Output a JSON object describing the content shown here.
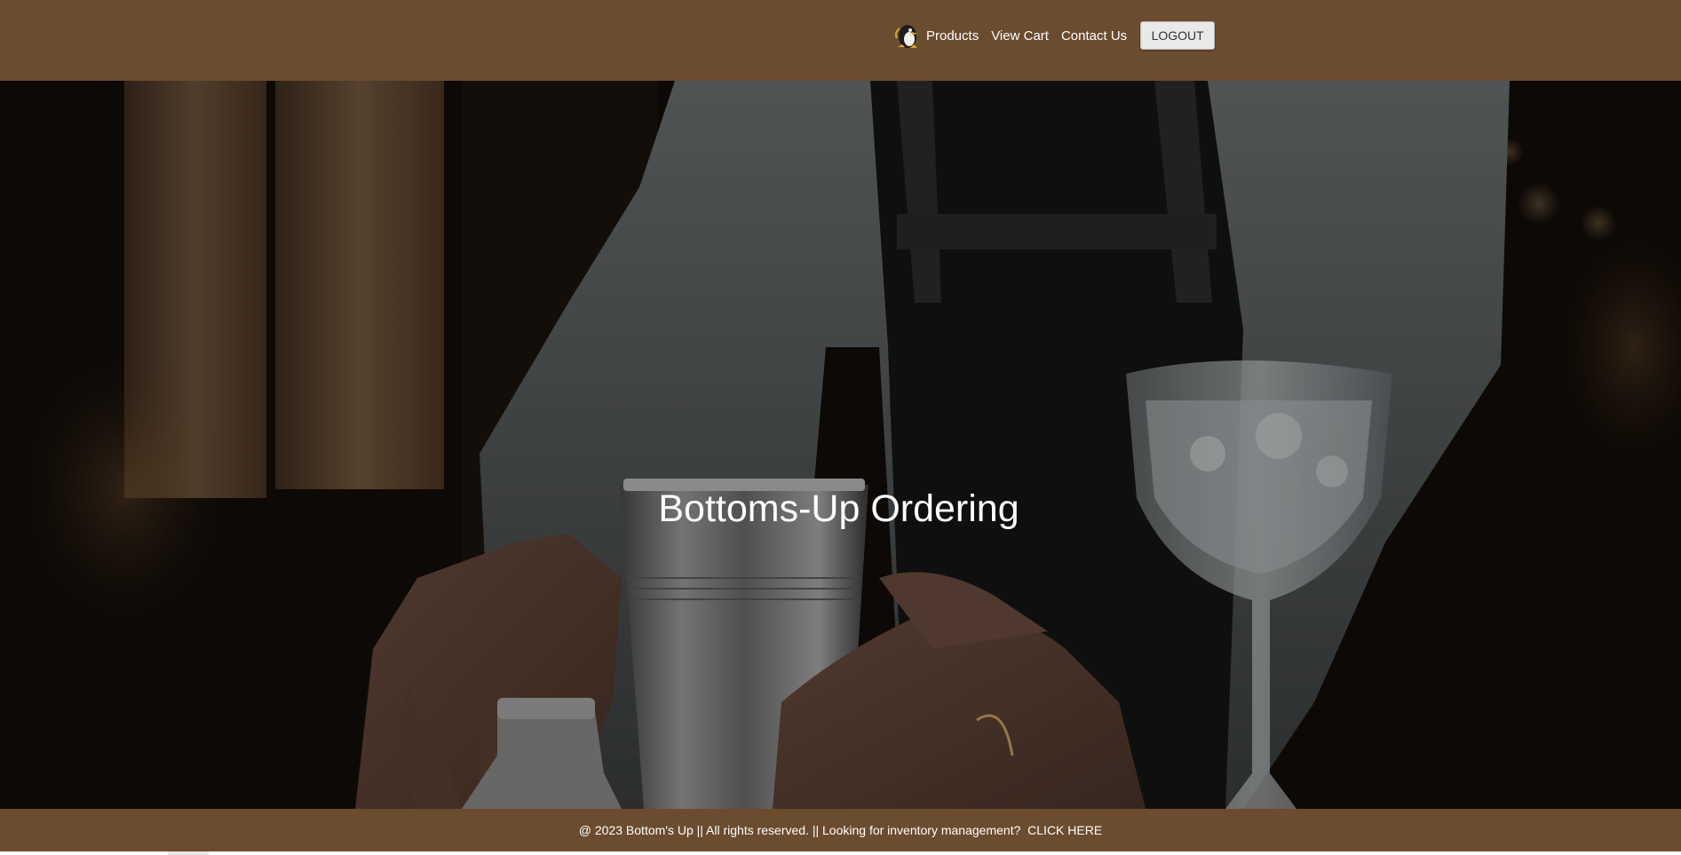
{
  "nav": {
    "logo_icon": "penguin-logo-icon",
    "links": [
      "Products",
      "View Cart",
      "Contact Us"
    ],
    "logout_label": "LOGOUT"
  },
  "hero": {
    "title": "Bottoms-Up Ordering"
  },
  "footer": {
    "text": "@ 2023 Bottom's Up || All rights reserved. || Looking for inventory management?  ",
    "link_label": "CLICK HERE"
  },
  "colors": {
    "nav_bg": "#6b4c2e",
    "footer_bg": "#6b4c2e",
    "button_bg": "#e9e9ea"
  }
}
